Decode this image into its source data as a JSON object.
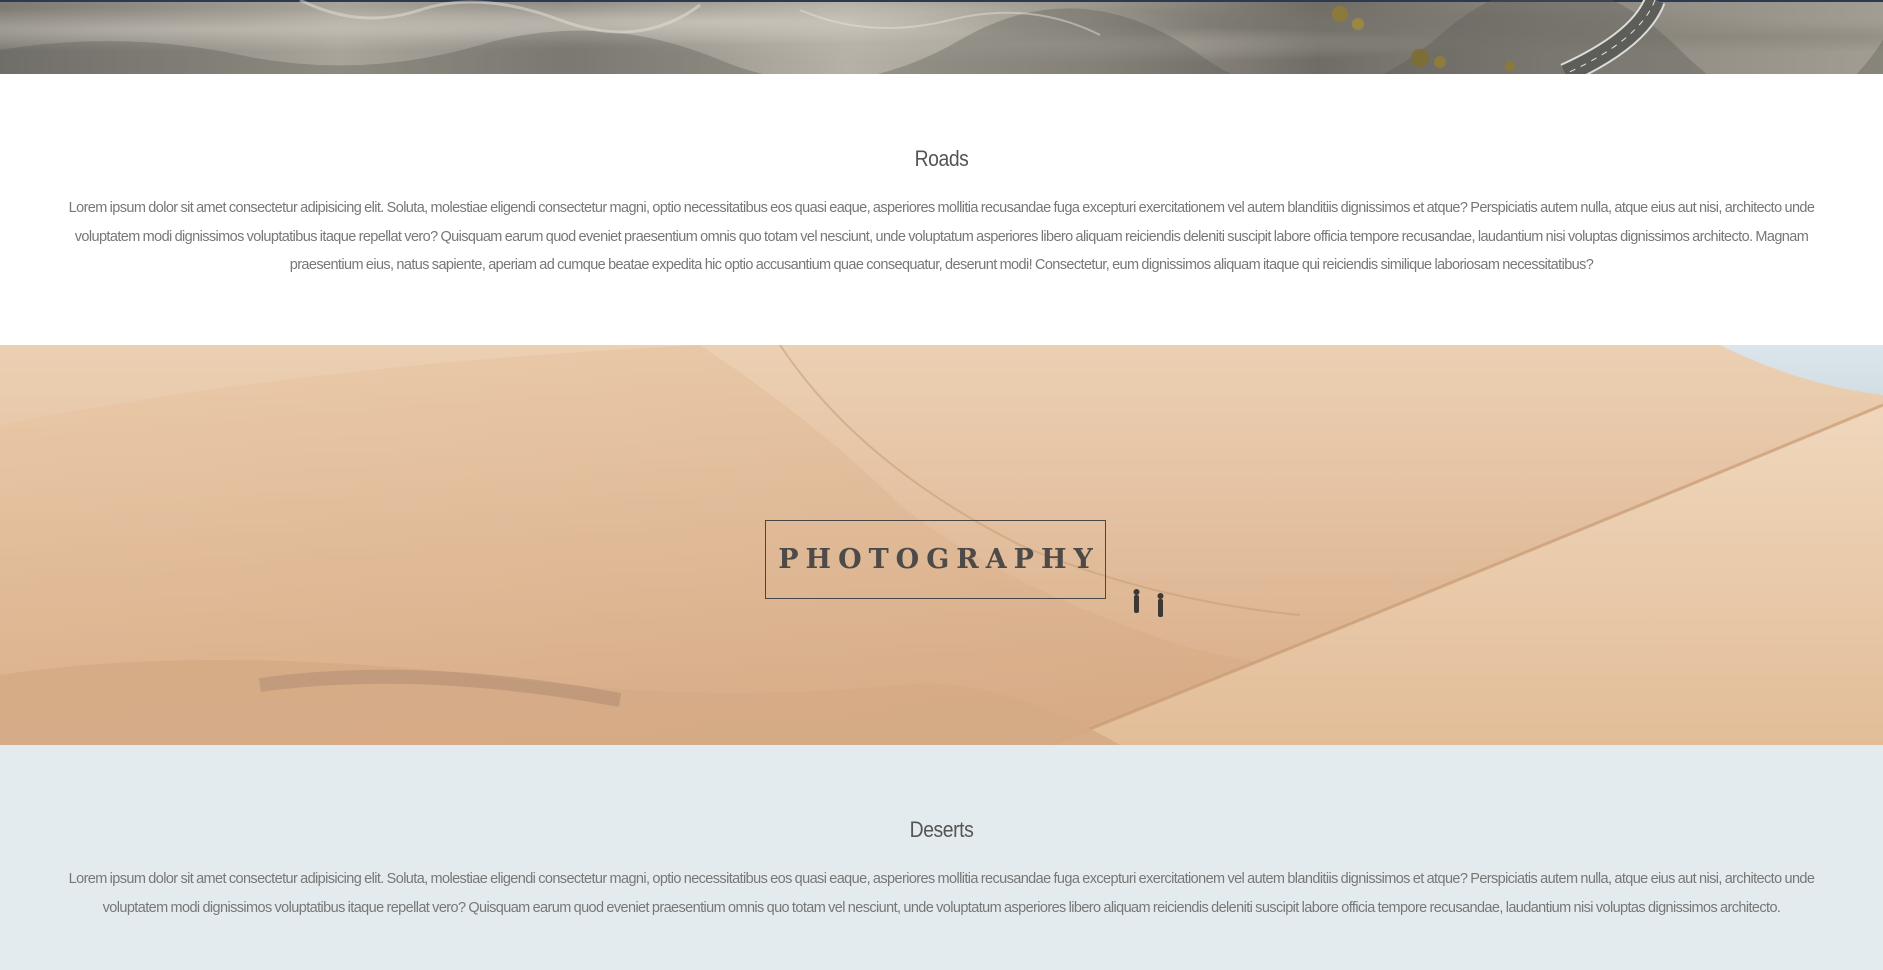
{
  "sections": {
    "roads": {
      "title": "Roads",
      "body": "Lorem ipsum dolor sit amet consectetur adipisicing elit. Soluta, molestiae eligendi consectetur magni, optio necessitatibus eos quasi eaque, asperiores mollitia recusandae fuga excepturi exercitationem vel autem blanditiis dignissimos et atque? Perspiciatis autem nulla, atque eius aut nisi, architecto unde voluptatem modi dignissimos voluptatibus itaque repellat vero? Quisquam earum quod eveniet praesentium omnis quo totam vel nesciunt, unde voluptatum asperiores libero aliquam reiciendis deleniti suscipit labore officia tempore recusandae, laudantium nisi voluptas dignissimos architecto. Magnam praesentium eius, natus sapiente, aperiam ad cumque beatae expedita hic optio accusantium quae consequatur, deserunt modi! Consectetur, eum dignissimos aliquam itaque qui reiciendis similique laboriosam necessitatibus?"
    },
    "hero": {
      "label": "PHOTOGRAPHY"
    },
    "deserts": {
      "title": "Deserts",
      "body": "Lorem ipsum dolor sit amet consectetur adipisicing elit. Soluta, molestiae eligendi consectetur magni, optio necessitatibus eos quasi eaque, asperiores mollitia recusandae fuga excepturi exercitationem vel autem blanditiis dignissimos et atque? Perspiciatis autem nulla, atque eius aut nisi, architecto unde voluptatem modi dignissimos voluptatibus itaque repellat vero? Quisquam earum quod eveniet praesentium omnis quo totam vel nesciunt, unde voluptatum asperiores libero aliquam reiciendis deleniti suscipit labore officia tempore recusandae, laudantium nisi voluptas dignissimos architecto."
    }
  },
  "colors": {
    "text_heading": "#555555",
    "text_body": "#777777",
    "deserts_background": "#e4ebee",
    "photo_label": "#4d4a48"
  }
}
